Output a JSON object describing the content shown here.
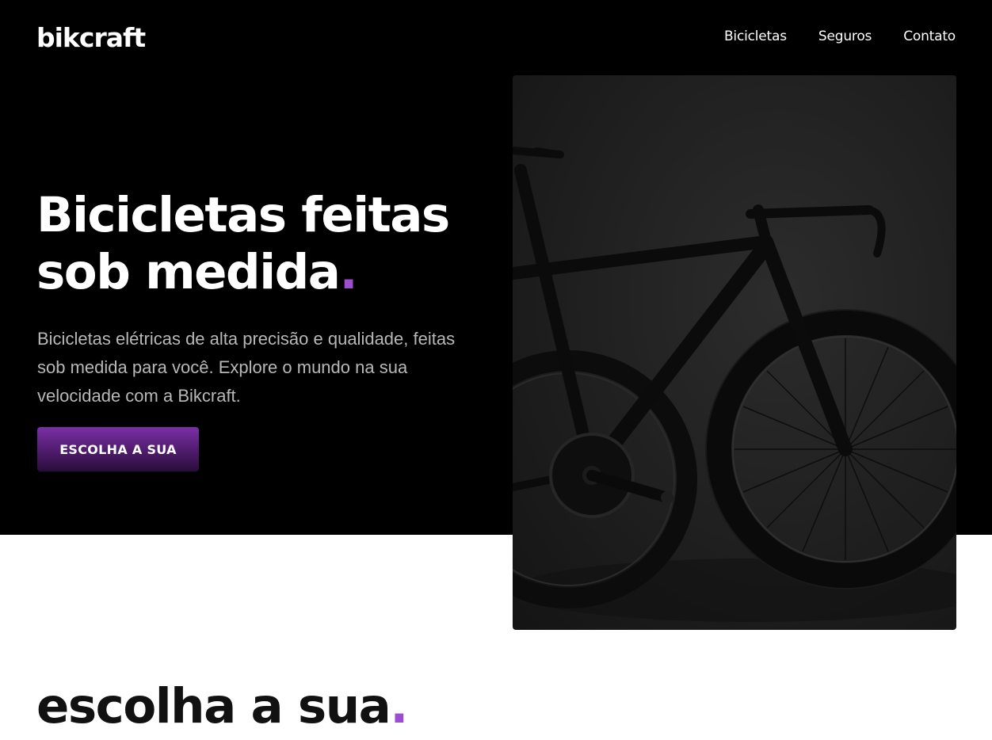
{
  "header": {
    "logo": "bikcraft",
    "nav": [
      {
        "label": "Bicicletas"
      },
      {
        "label": "Seguros"
      },
      {
        "label": "Contato"
      }
    ]
  },
  "hero": {
    "title_line1": "Bicicletas feitas",
    "title_line2": "sob medida",
    "dot": ".",
    "text": "Bicicletas elétricas de alta precisão e qualidade, feitas sob medida para você. Explore o mundo na sua velocidade com a Bikcraft.",
    "button": "ESCOLHA A SUA"
  },
  "section": {
    "title": "escolha a sua",
    "dot": "."
  },
  "colors": {
    "accent": "#9b4fcf",
    "hero_bg": "#000000"
  }
}
